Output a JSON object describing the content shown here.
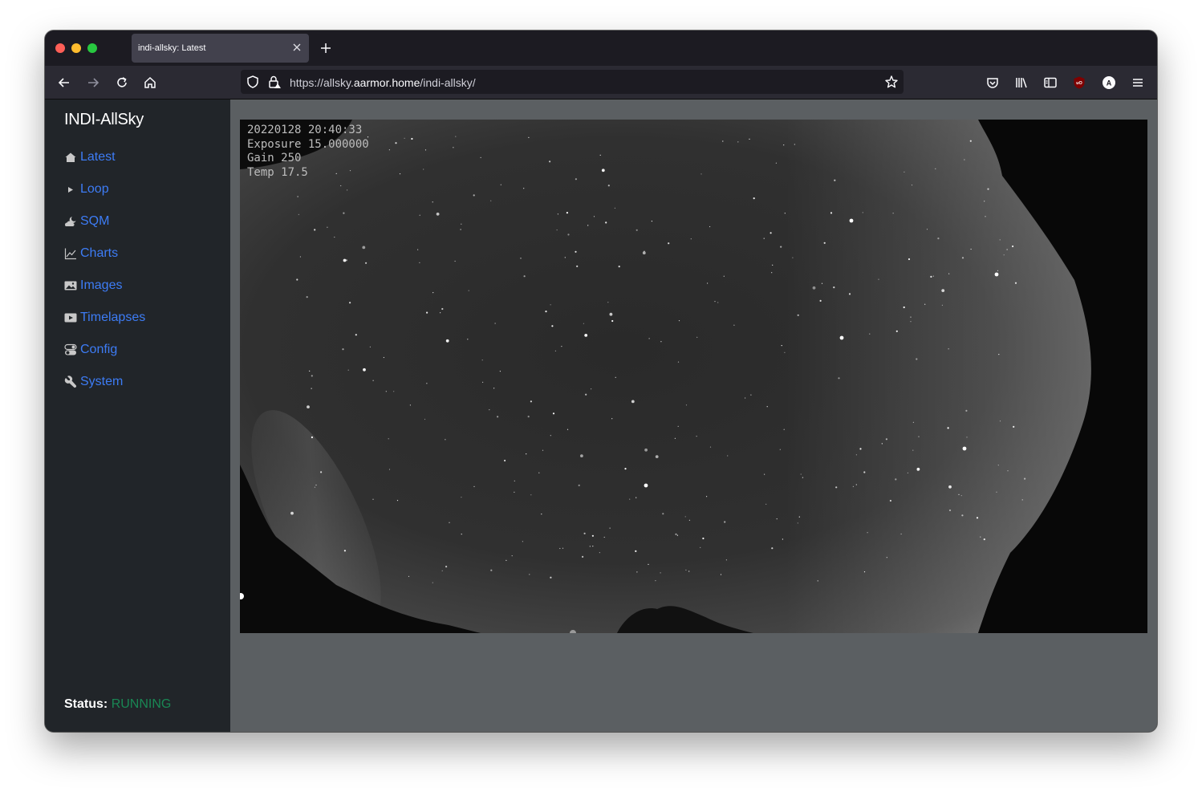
{
  "browser": {
    "tab_title": "indi-allsky: Latest",
    "url_prefix": "https://allsky.",
    "url_host": "aarmor.home",
    "url_path": "/indi-allsky/"
  },
  "sidebar": {
    "brand": "INDI-AllSky",
    "items": [
      {
        "label": "Latest",
        "icon": "house-icon"
      },
      {
        "label": "Loop",
        "icon": "play-triangle-icon"
      },
      {
        "label": "SQM",
        "icon": "cloud-moon-icon"
      },
      {
        "label": "Charts",
        "icon": "graph-icon"
      },
      {
        "label": "Images",
        "icon": "image-icon"
      },
      {
        "label": "Timelapses",
        "icon": "video-play-icon"
      },
      {
        "label": "Config",
        "icon": "toggles-icon"
      },
      {
        "label": "System",
        "icon": "wrench-icon"
      }
    ],
    "status_label": "Status:",
    "status_value": "RUNNING"
  },
  "image_overlay": {
    "date_line": "20220128 20:40:33",
    "exposure_line": "Exposure 15.000000",
    "gain_line": "Gain 250",
    "temp_line": "Temp 17.5"
  },
  "colors": {
    "link": "#3d7cf5",
    "status_running": "#198754",
    "sidebar_bg": "#212529",
    "main_bg": "#5b5f62"
  }
}
